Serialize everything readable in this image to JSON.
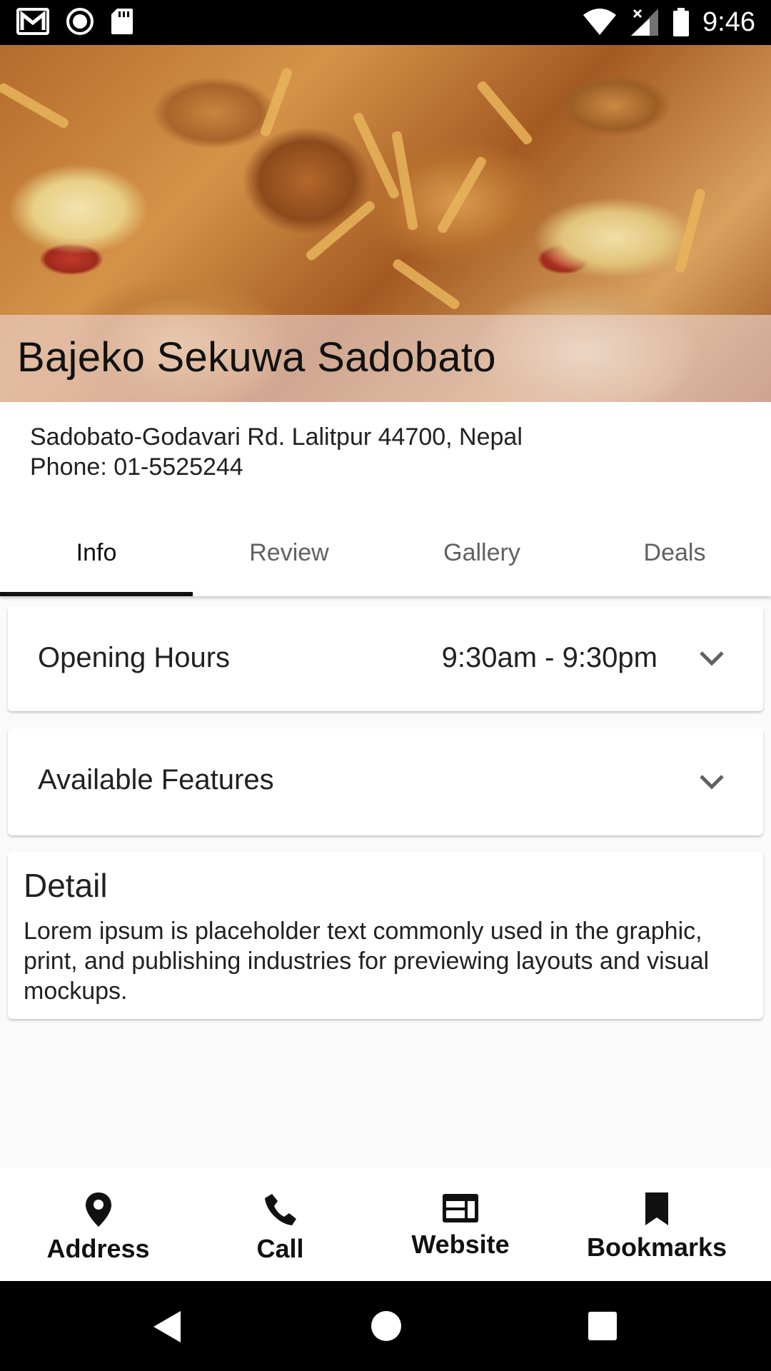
{
  "status_bar": {
    "time": "9:46",
    "left_icons": [
      "gmail-icon",
      "record-icon",
      "sd-card-icon"
    ],
    "right_icons": [
      "wifi-icon",
      "signal-icon",
      "battery-icon"
    ]
  },
  "restaurant": {
    "name": "Bajeko Sekuwa Sadobato",
    "address": "Sadobato-Godavari Rd. Lalitpur 44700, Nepal",
    "phone": "Phone: 01-5525244"
  },
  "tabs": [
    {
      "label": "Info",
      "active": true
    },
    {
      "label": "Review",
      "active": false
    },
    {
      "label": "Gallery",
      "active": false
    },
    {
      "label": "Deals",
      "active": false
    }
  ],
  "opening_hours": {
    "label": "Opening Hours",
    "value": "9:30am - 9:30pm"
  },
  "available_features": {
    "label": "Available Features"
  },
  "detail": {
    "title": "Detail",
    "body": "Lorem ipsum is placeholder text commonly used in the graphic, print, and publishing industries for previewing layouts and visual mockups."
  },
  "actions": [
    {
      "label": "Address",
      "icon": "location-pin-icon"
    },
    {
      "label": "Call",
      "icon": "phone-icon"
    },
    {
      "label": "Website",
      "icon": "web-icon"
    },
    {
      "label": "Bookmarks",
      "icon": "bookmark-icon"
    }
  ],
  "nav": [
    "back-icon",
    "home-icon",
    "recents-icon"
  ],
  "colors": {
    "accent": "#111111",
    "tab_inactive": "#616161",
    "page_bg": "#fafafa"
  }
}
